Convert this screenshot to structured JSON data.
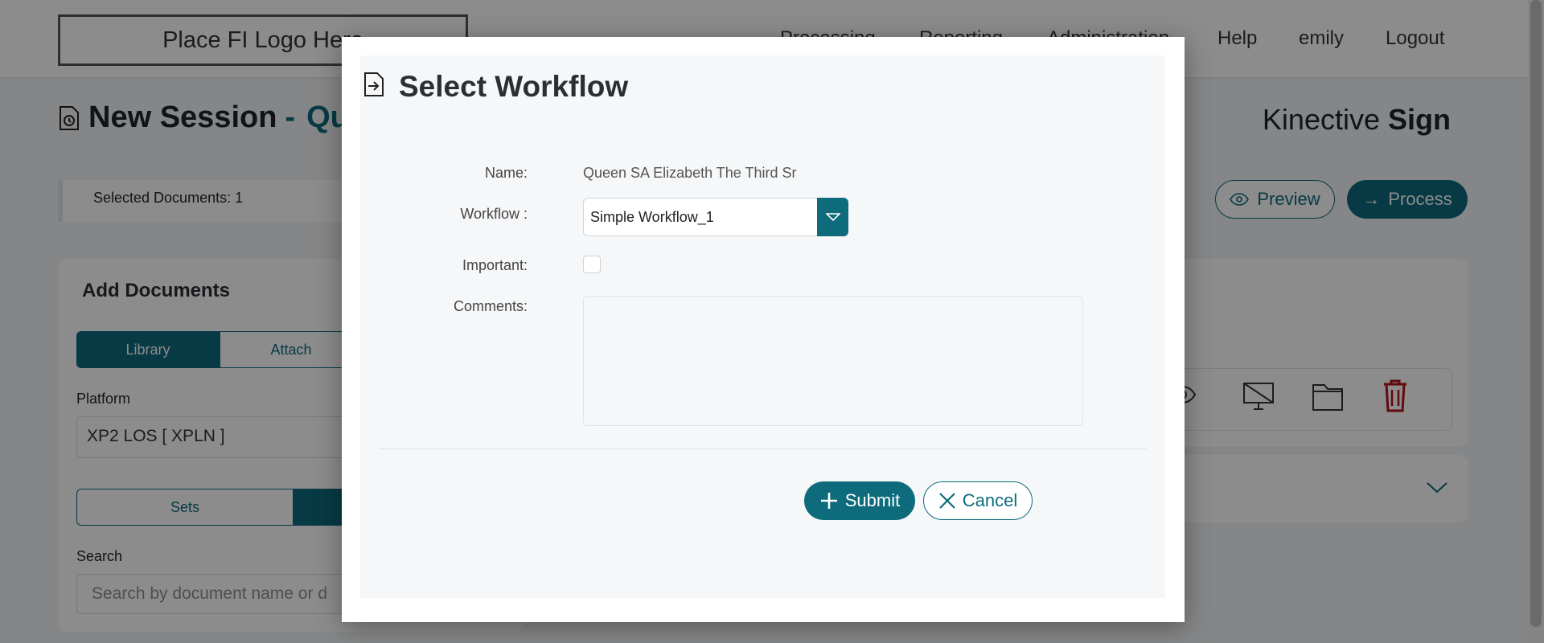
{
  "app": {
    "logo_text": "Place FI Logo Here",
    "nav": {
      "processing": "Processing",
      "reporting": "Reporting",
      "administration": "Administration",
      "help": "Help",
      "user": "emily",
      "logout": "Logout"
    },
    "brand_prefix": "Kinective",
    "brand_suffix": "Sign"
  },
  "page": {
    "title": "New Session",
    "title_dash": "-",
    "customer_partial": "Qu",
    "selected_documents": "Selected Documents: 1",
    "preview_label": "Preview",
    "process_label": "Process",
    "add_documents": {
      "heading": "Add Documents",
      "tabs": [
        "Library",
        "Attach"
      ],
      "active_tab": "Library",
      "platform_label": "Platform",
      "platform_value": "XP2 LOS [ XPLN ]",
      "set_tabs": [
        "Sets",
        ""
      ],
      "search_label": "Search",
      "search_placeholder": "Search by document name or d"
    }
  },
  "modal": {
    "title": "Select Workflow",
    "name_label": "Name:",
    "name_value": "Queen SA Elizabeth The Third Sr",
    "workflow_label": "Workflow :",
    "workflow_value": "Simple Workflow_1",
    "important_label": "Important:",
    "important_checked": false,
    "comments_label": "Comments:",
    "comments_value": "",
    "submit_label": "Submit",
    "cancel_label": "Cancel"
  },
  "colors": {
    "accent": "#0d6b7c",
    "delete": "#b3121b"
  }
}
